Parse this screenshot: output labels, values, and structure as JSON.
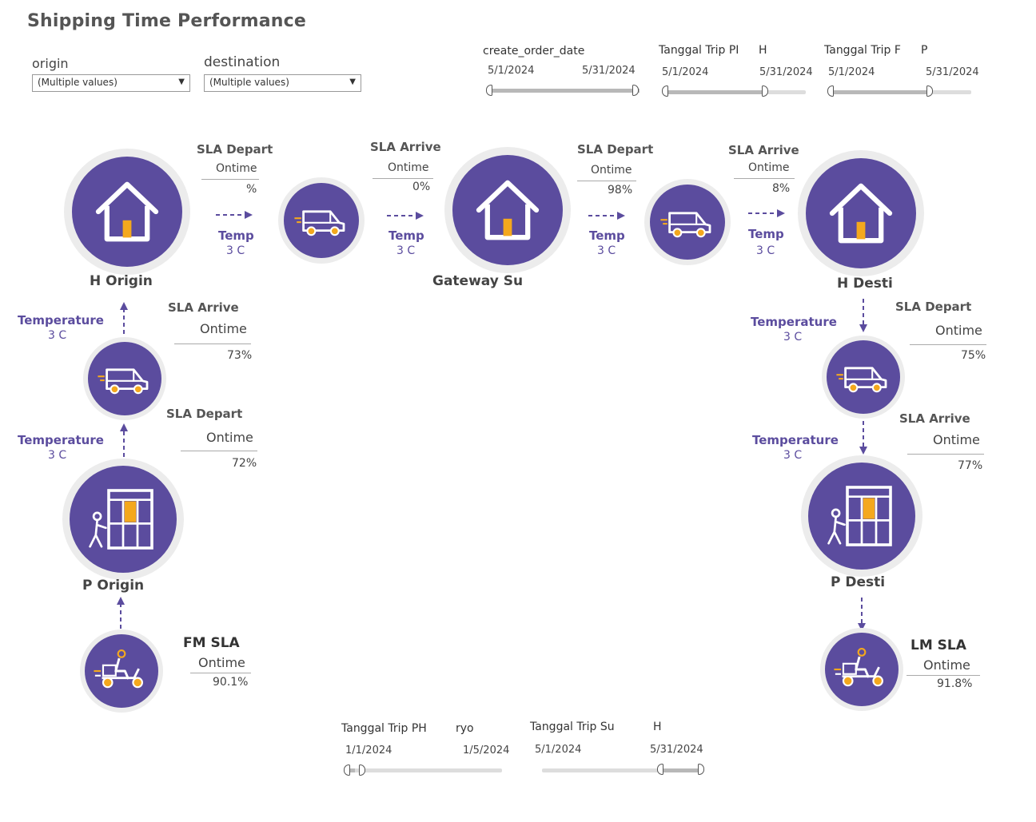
{
  "title": "Shipping Time Performance",
  "filters": {
    "origin": {
      "label": "origin",
      "value": "(Multiple values)"
    },
    "destination": {
      "label": "destination",
      "value": "(Multiple values)"
    }
  },
  "sliders_top": [
    {
      "label": "create_order_date",
      "start": "5/1/2024",
      "end": "5/31/2024"
    },
    {
      "label": "Tanggal Trip PI",
      "label2": "H",
      "start": "5/1/2024",
      "end": "5/31/2024"
    },
    {
      "label": "Tanggal Trip F",
      "label2": "P",
      "start": "5/1/2024",
      "end": "5/31/2024"
    }
  ],
  "sliders_bottom": [
    {
      "label": "Tanggal Trip PH",
      "label2": "ryo",
      "start": "1/1/2024",
      "end": "1/5/2024"
    },
    {
      "label": "Tanggal Trip Su",
      "label2": "H",
      "start": "5/1/2024",
      "end": "5/31/2024"
    }
  ],
  "top_flow": [
    {
      "heading": "SLA Depart",
      "status": "Ontime",
      "value": "%",
      "temp_label": "Temp",
      "temp_value": "3 C"
    },
    {
      "heading": "SLA Arrive",
      "status": "Ontime",
      "value": "0%",
      "temp_label": "Temp",
      "temp_value": "3 C"
    },
    {
      "heading": "SLA Depart",
      "status": "Ontime",
      "value": "98%",
      "temp_label": "Temp",
      "temp_value": "3 C"
    },
    {
      "heading": "SLA Arrive",
      "status": "Ontime",
      "value": "8%",
      "temp_label": "Temp",
      "temp_value": "3 C"
    }
  ],
  "nodes": {
    "h_origin": "H Origin",
    "gateway": "Gateway Su",
    "h_dest": "H Desti",
    "p_origin": "P Origin",
    "p_dest": "P Desti"
  },
  "left_flow": [
    {
      "heading": "SLA Arrive",
      "status": "Ontime",
      "value": "73%",
      "temp_label": "Temperature",
      "temp_value": "3 C"
    },
    {
      "heading": "SLA Depart",
      "status": "Ontime",
      "value": "72%",
      "temp_label": "Temperature",
      "temp_value": "3 C"
    }
  ],
  "right_flow": [
    {
      "heading": "SLA Depart",
      "status": "Ontime",
      "value": "75%",
      "temp_label": "Temperature",
      "temp_value": "3 C"
    },
    {
      "heading": "SLA Arrive",
      "status": "Ontime",
      "value": "77%",
      "temp_label": "Temperature",
      "temp_value": "3 C"
    }
  ],
  "fm": {
    "heading": "FM SLA",
    "status": "Ontime",
    "value": "90.1%"
  },
  "lm": {
    "heading": "LM SLA",
    "status": "Ontime",
    "value": "91.8%"
  },
  "colors": {
    "node": "#5b4c9e",
    "accent": "#f4a81d",
    "ring": "#ececec"
  }
}
